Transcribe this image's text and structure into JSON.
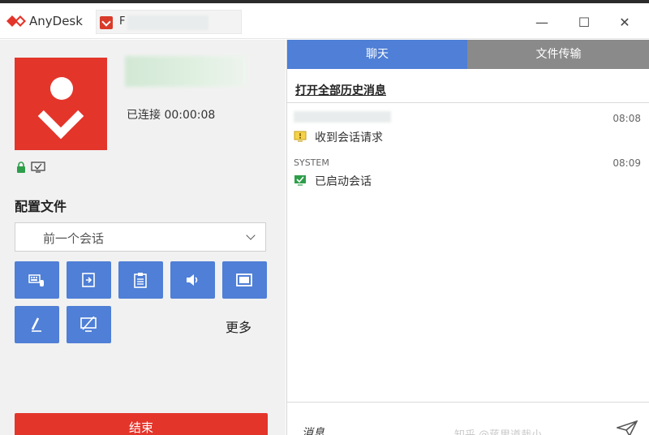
{
  "app": {
    "name": "AnyDesk",
    "tab_title": "F"
  },
  "window_controls": {
    "minimize": "—",
    "maximize": "☐",
    "close": "✕"
  },
  "left": {
    "status": "已连接 00:00:08",
    "profile_title": "配置文件",
    "profile_select": {
      "value": "前一个会话"
    },
    "tools": [
      {
        "icon": "keyboard-mouse-icon"
      },
      {
        "icon": "switch-sides-icon"
      },
      {
        "icon": "clipboard-icon"
      },
      {
        "icon": "audio-icon"
      },
      {
        "icon": "screen-icon"
      },
      {
        "icon": "draw-icon"
      },
      {
        "icon": "block-input-icon"
      }
    ],
    "more_label": "更多",
    "end_label": "结束"
  },
  "right": {
    "tabs": {
      "chat": "聊天",
      "file_transfer": "文件传输"
    },
    "history_link": "打开全部历史消息",
    "messages": [
      {
        "time": "08:08",
        "icon": "session-request-icon",
        "text": "收到会话请求"
      },
      {
        "sender": "SYSTEM",
        "time": "08:09",
        "icon": "session-started-icon",
        "text": "已启动会话"
      }
    ],
    "input_placeholder": "消息",
    "watermark": "知乎 @蒋里道哉小"
  },
  "colors": {
    "brand_red": "#e4352b",
    "accent_blue": "#4f7fd6",
    "tab_gray": "#8a8a8a"
  }
}
